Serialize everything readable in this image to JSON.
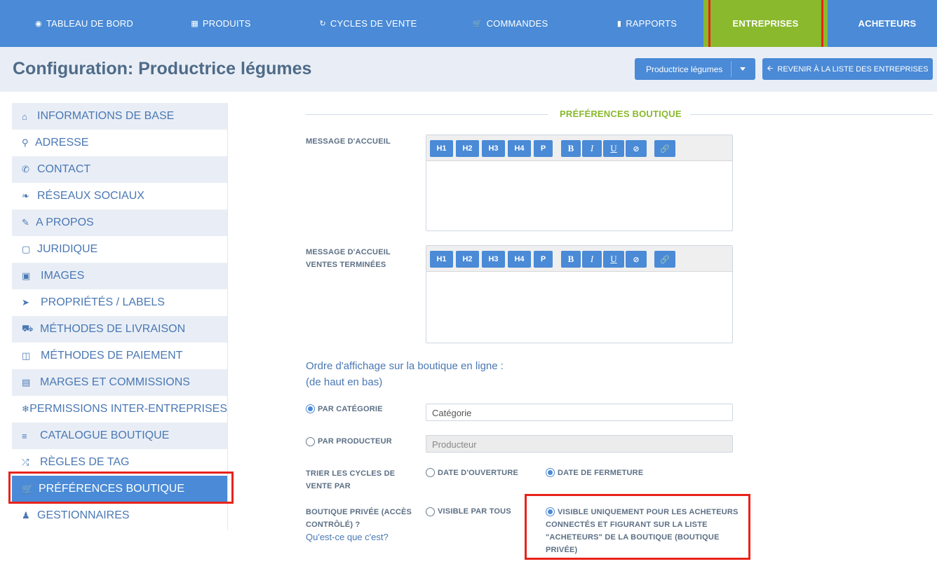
{
  "nav": {
    "items": [
      {
        "label": "TABLEAU DE BORD",
        "icon": "dashboard-icon"
      },
      {
        "label": "PRODUITS",
        "icon": "grid-icon"
      },
      {
        "label": "CYCLES DE VENTE",
        "icon": "refresh-icon"
      },
      {
        "label": "COMMANDES",
        "icon": "cart-icon"
      },
      {
        "label": "RAPPORTS",
        "icon": "file-icon"
      },
      {
        "label": "ENTREPRISES",
        "icon": ""
      },
      {
        "label": "ACHETEURS",
        "icon": ""
      }
    ],
    "active": "ENTREPRISES"
  },
  "header": {
    "title": "Configuration: Productrice légumes",
    "company_select": "Productrice légumes",
    "back_button": "REVENIR À LA LISTE DES ENTREPRISES"
  },
  "sidebar": {
    "items": [
      {
        "label": "INFORMATIONS DE BASE",
        "icon": "home-icon"
      },
      {
        "label": "ADRESSE",
        "icon": "map-marker-icon"
      },
      {
        "label": "CONTACT",
        "icon": "phone-icon"
      },
      {
        "label": "RÉSEAUX SOCIAUX",
        "icon": "twitter-icon"
      },
      {
        "label": "A PROPOS",
        "icon": "pencil-icon"
      },
      {
        "label": "JURIDIQUE",
        "icon": "briefcase-icon"
      },
      {
        "label": "IMAGES",
        "icon": "image-icon"
      },
      {
        "label": "PROPRIÉTÉS / LABELS",
        "icon": "tags-icon"
      },
      {
        "label": "MÉTHODES DE LIVRAISON",
        "icon": "truck-icon"
      },
      {
        "label": "MÉTHODES DE PAIEMENT",
        "icon": "money-icon"
      },
      {
        "label": "MARGES ET COMMISSIONS",
        "icon": "credit-card-icon"
      },
      {
        "label": "PERMISSIONS INTER-ENTREPRISES",
        "icon": "plug-icon"
      },
      {
        "label": "CATALOGUE BOUTIQUE",
        "icon": "list-icon"
      },
      {
        "label": "RÈGLES DE TAG",
        "icon": "random-icon"
      },
      {
        "label": "PRÉFÉRENCES BOUTIQUE",
        "icon": "cart-icon"
      },
      {
        "label": "GESTIONNAIRES",
        "icon": "user-icon"
      }
    ],
    "active": "PRÉFÉRENCES BOUTIQUE"
  },
  "main": {
    "section_title": "PRÉFÉRENCES BOUTIQUE",
    "welcome_label": "MESSAGE D'ACCUEIL",
    "welcome_closed_label": "MESSAGE D'ACCUEIL VENTES TERMINÉES",
    "toolbar": [
      "H1",
      "H2",
      "H3",
      "H4",
      "P",
      "B",
      "I",
      "U",
      "⊘",
      "🔗"
    ],
    "order_title_line1": "Ordre d'affichage sur la boutique en ligne :",
    "order_title_line2": "(de haut en bas)",
    "by_category": {
      "label": "PAR CATÉGORIE",
      "checked": true,
      "input_value": "Catégorie"
    },
    "by_producer": {
      "label": "PAR PRODUCTEUR",
      "checked": false,
      "input_value": "Producteur"
    },
    "sort_label": "TRIER LES CYCLES DE VENTE PAR",
    "sort_open": {
      "label": "DATE D'OUVERTURE",
      "checked": false
    },
    "sort_close": {
      "label": "DATE DE FERMETURE",
      "checked": true
    },
    "private_label": "BOUTIQUE PRIVÉE (ACCÈS CONTRÔLÉ) ?",
    "private_link": "Qu'est-ce que c'est?",
    "visible_all": {
      "label": "VISIBLE PAR TOUS",
      "checked": false
    },
    "visible_private": {
      "label": "VISIBLE UNIQUEMENT POUR LES ACHETEURS CONNECTÉS ET FIGURANT SUR LA LISTE \"ACHETEURS\" DE LA BOUTIQUE (BOUTIQUE PRIVÉE)",
      "checked": true
    }
  },
  "colors": {
    "primary": "#4a8ad6",
    "active_nav": "#8ab92d",
    "highlight": "#e8231b"
  }
}
